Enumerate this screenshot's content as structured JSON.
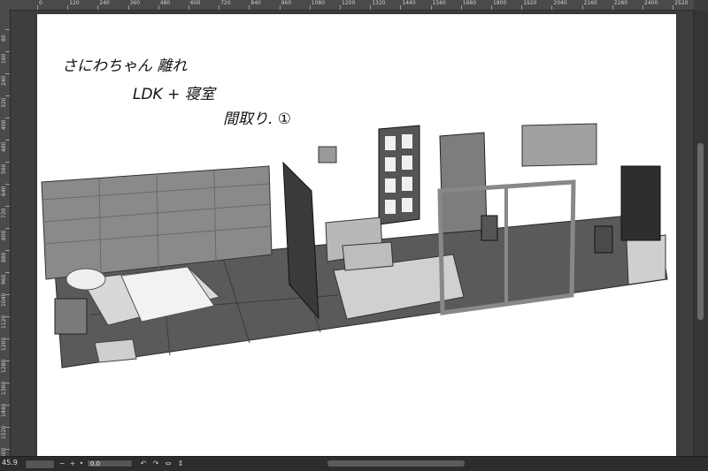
{
  "ruler": {
    "h_ticks": [
      "0",
      "120",
      "240",
      "360",
      "480",
      "600",
      "720",
      "840",
      "960",
      "1080",
      "1200",
      "1320",
      "1440",
      "1560",
      "1680",
      "1800",
      "1920",
      "2040",
      "2160",
      "2280",
      "2400",
      "2520"
    ],
    "v_ticks": [
      "80",
      "160",
      "240",
      "320",
      "400",
      "480",
      "560",
      "640",
      "720",
      "800",
      "880",
      "960",
      "1040",
      "1120",
      "1200",
      "1280",
      "1360",
      "1440",
      "1520",
      "1600"
    ]
  },
  "canvas": {
    "handwriting_line1": "さにわちゃん 離れ",
    "handwriting_line2": "LDK + 寝室",
    "handwriting_line3": "間取り. ①"
  },
  "status": {
    "zoom": "45.9",
    "angle": "0.0"
  }
}
